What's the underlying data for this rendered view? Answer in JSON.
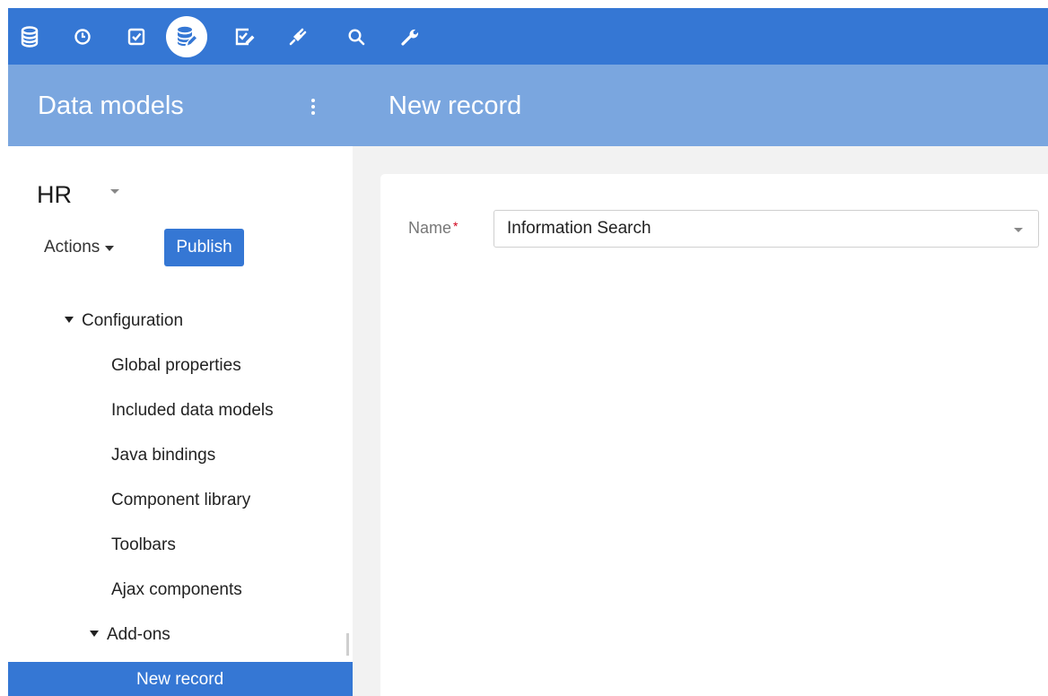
{
  "toolbar": {
    "icons": [
      {
        "name": "database-icon",
        "active": false
      },
      {
        "name": "clock-icon",
        "active": false
      },
      {
        "name": "checkbox-icon",
        "active": false
      },
      {
        "name": "data-model-edit-icon",
        "active": true
      },
      {
        "name": "checklist-edit-icon",
        "active": false
      },
      {
        "name": "plug-icon",
        "active": false
      },
      {
        "name": "search-icon",
        "active": false
      },
      {
        "name": "wrench-icon",
        "active": false
      }
    ]
  },
  "header": {
    "left_title": "Data models",
    "right_title": "New record"
  },
  "sidebar": {
    "model_name": "HR",
    "actions_label": "Actions",
    "publish_label": "Publish",
    "tree": [
      {
        "label": "Configuration",
        "expanded": true,
        "selected": false
      },
      {
        "label": "Global properties",
        "selected": false
      },
      {
        "label": "Included data models",
        "selected": false
      },
      {
        "label": "Java bindings",
        "selected": false
      },
      {
        "label": "Component library",
        "selected": false
      },
      {
        "label": "Toolbars",
        "selected": false
      },
      {
        "label": "Ajax components",
        "selected": false
      },
      {
        "label": "Add-ons",
        "expanded": true,
        "selected": false
      },
      {
        "label": "New record",
        "selected": true
      }
    ]
  },
  "form": {
    "name_label": "Name",
    "required_mark": "*",
    "name_value": "Information Search"
  },
  "colors": {
    "primary": "#3577d4",
    "header_band": "#7aa6df",
    "required": "#d0021b"
  }
}
